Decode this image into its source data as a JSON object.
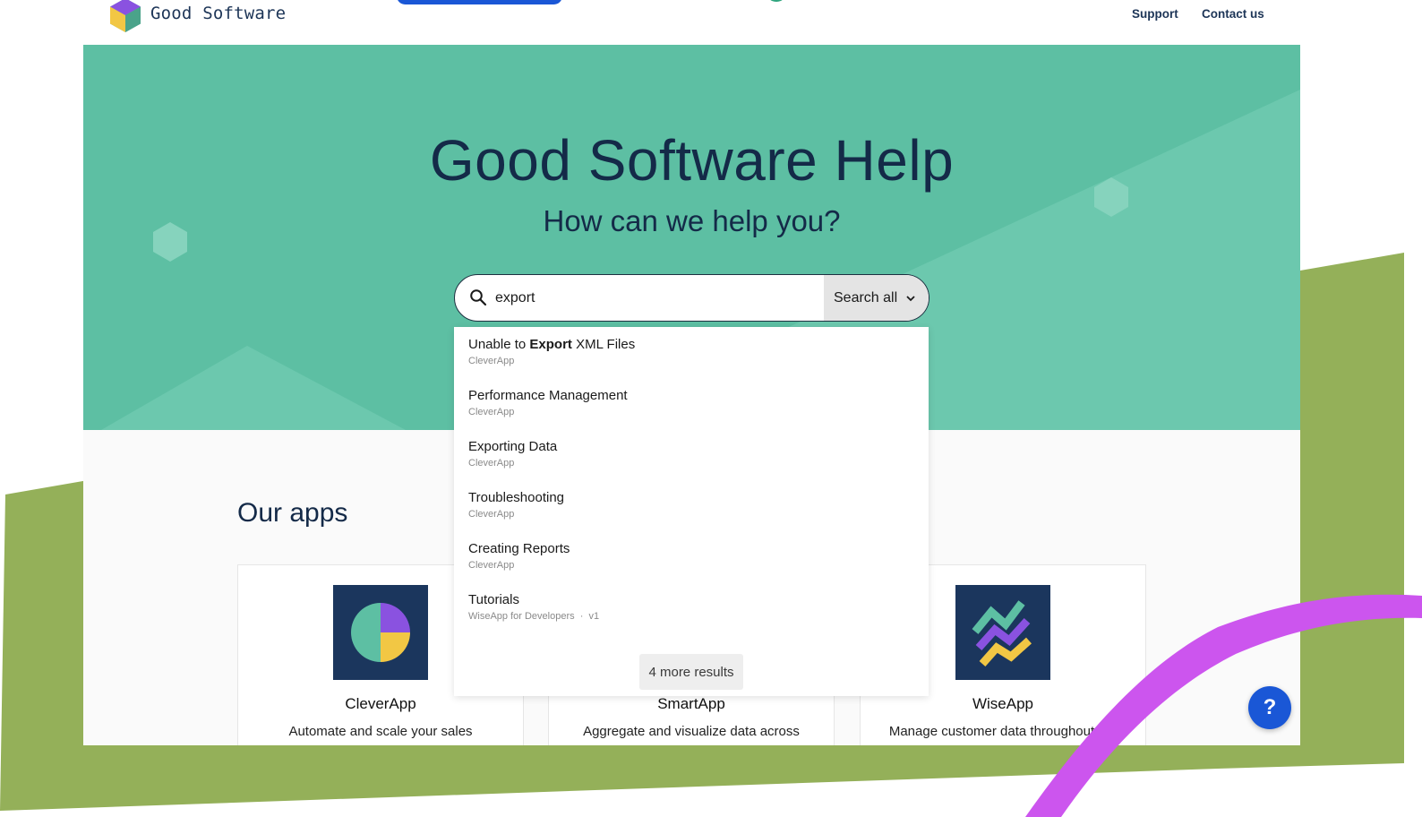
{
  "brand": {
    "name": "Good Software"
  },
  "nav": {
    "support": "Support",
    "contact": "Contact us"
  },
  "hero": {
    "title": "Good Software Help",
    "subtitle": "How can we help you?"
  },
  "search": {
    "value": "export",
    "scope_label": "Search all"
  },
  "results": [
    {
      "title_prefix": "Unable to ",
      "title_match": "Export",
      "title_suffix": " XML Files",
      "meta": "CleverApp"
    },
    {
      "title": "Performance Management",
      "meta": "CleverApp"
    },
    {
      "title": "Exporting Data",
      "meta": "CleverApp"
    },
    {
      "title": "Troubleshooting",
      "meta": "CleverApp"
    },
    {
      "title": "Creating Reports",
      "meta": "CleverApp"
    },
    {
      "title": "Tutorials",
      "meta": "WiseApp for Developers",
      "version": "v1"
    }
  ],
  "more_results_label": "4 more results",
  "apps_section": {
    "title": "Our apps",
    "apps": [
      {
        "name": "CleverApp",
        "description": "Automate and scale your sales"
      },
      {
        "name": "SmartApp",
        "description": "Aggregate and visualize data across"
      },
      {
        "name": "WiseApp",
        "description": "Manage customer data throughout the"
      }
    ]
  },
  "help_button": {
    "label": "?"
  },
  "colors": {
    "hero": "#5dbfa3",
    "navy": "#142a48",
    "accent_blue": "#1a57d6",
    "deco_green": "#94b059",
    "deco_purple": "#cc55ee"
  },
  "icons": [
    "hexagon-logo-icon",
    "search-icon",
    "chevron-down-icon",
    "cleverapp-icon",
    "wiseapp-icon",
    "help-icon"
  ]
}
